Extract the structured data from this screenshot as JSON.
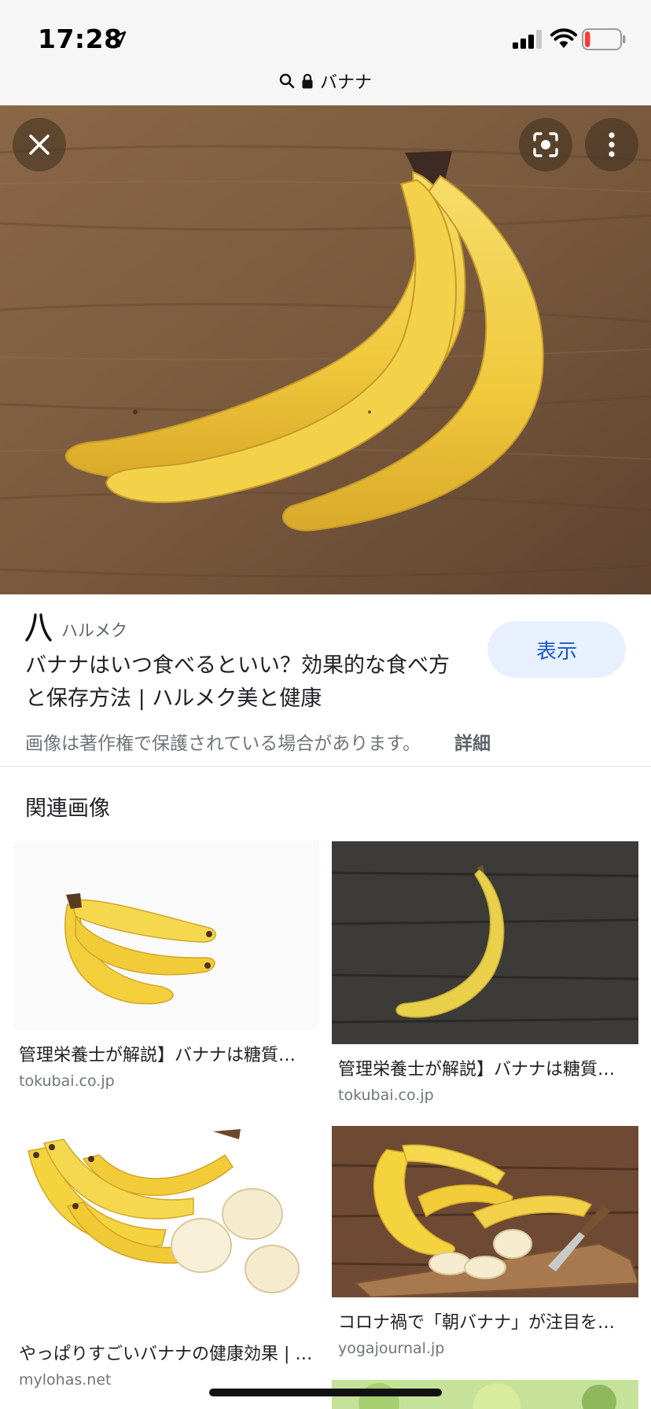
{
  "status_bar": {
    "time": "17:28",
    "battery_level": 0.15,
    "battery_color": "#ff3b30"
  },
  "url_bar": {
    "text": "バナナ",
    "icons": [
      "search-icon",
      "lock-icon"
    ]
  },
  "hero": {
    "close_icon": "close-icon",
    "lens_icon": "lens-icon",
    "more_icon": "more-vertical-icon"
  },
  "result": {
    "source_name": "ハルメク",
    "source_logo": "ハ",
    "title": "バナナはいつ食べるといい？効果的な食べ方と保存方法 | ハルメク美と健康",
    "view_button": "表示",
    "copyright_notice": "画像は著作権で保護されている場合があります。",
    "details_link": "詳細"
  },
  "related": {
    "heading": "関連画像",
    "items": [
      {
        "title": "管理栄養士が解説】バナナは糖質が多い？",
        "domain": "tokubai.co.jp"
      },
      {
        "title": "管理栄養士が解説】バナナは糖質が多い？",
        "domain": "tokubai.co.jp"
      },
      {
        "title": "やっぱりすごいバナナの健康効果 | mylohas",
        "domain": "mylohas.net"
      },
      {
        "title": "コロナ禍で「朝バナナ」が注目を集める理由",
        "domain": "yogajournal.jp"
      }
    ]
  },
  "colors": {
    "accent": "#1a56c9",
    "button_bg": "#e8f0fe",
    "banana": "#f2d045",
    "wood": "#7a5a3e"
  }
}
